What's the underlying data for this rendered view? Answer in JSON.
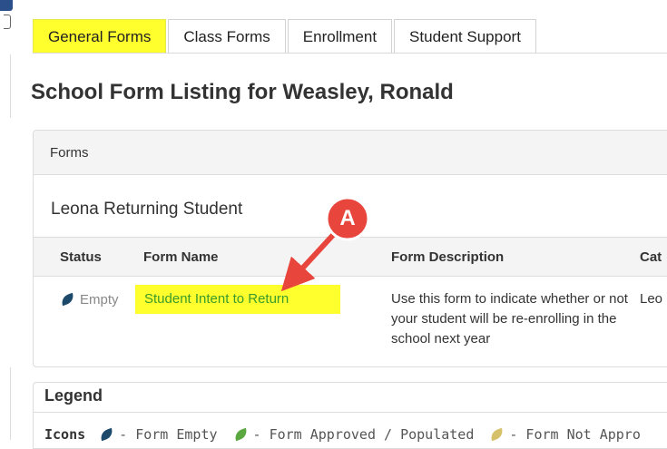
{
  "tabs": [
    {
      "label": "General Forms",
      "active": true
    },
    {
      "label": "Class Forms",
      "active": false
    },
    {
      "label": "Enrollment",
      "active": false
    },
    {
      "label": "Student Support",
      "active": false
    }
  ],
  "page": {
    "title": "School Form Listing for Weasley, Ronald"
  },
  "forms_panel": {
    "header": "Forms",
    "group_title": "Leona Returning Student",
    "columns": {
      "status": "Status",
      "form_name": "Form Name",
      "form_description": "Form Description",
      "category": "Cat"
    },
    "rows": [
      {
        "status": "Empty",
        "status_icon": "leaf-icon-empty",
        "form_name": "Student Intent to Return",
        "form_description": "Use this form to indicate whether or not your student will be re-enrolling in the school next year",
        "category": "Leo"
      }
    ]
  },
  "legend": {
    "title": "Legend",
    "icons_label": "Icons",
    "items": [
      {
        "label": "- Form Empty",
        "icon": "leaf-icon-empty",
        "color": "#1d4a6b"
      },
      {
        "label": "- Form Approved / Populated",
        "icon": "leaf-icon-approved",
        "color": "#5aa83f"
      },
      {
        "label": "- Form Not Appro",
        "icon": "leaf-icon-not-approved",
        "color": "#d6c06a"
      }
    ]
  },
  "annotation": {
    "label": "A",
    "color": "#e8453c"
  },
  "colors": {
    "highlight": "#ffff2e",
    "link": "#3b9a2a"
  }
}
